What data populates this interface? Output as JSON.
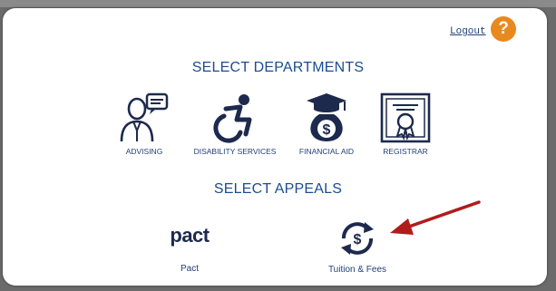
{
  "header": {
    "logout_label": "Logout",
    "help_label": "?"
  },
  "departments": {
    "heading": "SELECT DEPARTMENTS",
    "items": [
      {
        "label": "ADVISING",
        "icon": "advisor-icon"
      },
      {
        "label": "DISABILITY SERVICES",
        "icon": "wheelchair-icon"
      },
      {
        "label": "FINANCIAL AID",
        "icon": "money-bag-graduation-cap-icon"
      },
      {
        "label": "REGISTRAR",
        "icon": "certificate-icon"
      }
    ]
  },
  "appeals": {
    "heading": "SELECT APPEALS",
    "items": [
      {
        "label": "Pact",
        "logo_text": "pact",
        "icon": "pact-logo"
      },
      {
        "label": "Tuition & Fees",
        "icon": "dollar-refresh-icon"
      }
    ]
  },
  "annotation": {
    "icon": "red-arrow-icon",
    "color": "#b01c1c"
  },
  "colors": {
    "brand_blue": "#1a4d8f",
    "help_orange": "#e8891f",
    "icon_navy": "#1d2a4d"
  }
}
